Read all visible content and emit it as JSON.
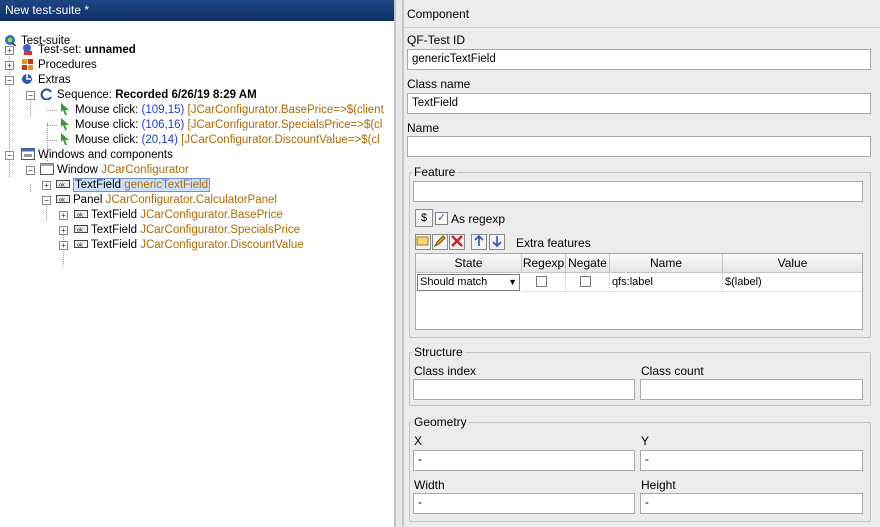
{
  "left": {
    "title": "New test-suite *",
    "tree": {
      "root": "Test-suite",
      "testset_prefix": "Test-set:",
      "testset_name": "unnamed",
      "procedures": "Procedures",
      "extras": "Extras",
      "sequence_prefix": "Sequence:",
      "sequence_name": "Recorded 6/26/19 8:29 AM",
      "clicks": [
        {
          "label": "Mouse click:",
          "coords": "(109,15)",
          "target": "[JCarConfigurator.BasePrice=>$(client"
        },
        {
          "label": "Mouse click:",
          "coords": "(106,16)",
          "target": "[JCarConfigurator.SpecialsPrice=>$(cl"
        },
        {
          "label": "Mouse click:",
          "coords": "(20,14)",
          "target": "[JCarConfigurator.DiscountValue=>$(cl"
        }
      ],
      "windows": "Windows and components",
      "window_prefix": "Window",
      "window_name": "JCarConfigurator",
      "selected_prefix": "TextField",
      "selected_name": "genericTextField",
      "panel_prefix": "Panel",
      "panel_name": "JCarConfigurator.CalculatorPanel",
      "fields": [
        {
          "prefix": "TextField",
          "name": "JCarConfigurator.BasePrice"
        },
        {
          "prefix": "TextField",
          "name": "JCarConfigurator.SpecialsPrice"
        },
        {
          "prefix": "TextField",
          "name": "JCarConfigurator.DiscountValue"
        }
      ]
    }
  },
  "right": {
    "title": "Component",
    "qf_id_label": "QF-Test ID",
    "qf_id_value": "genericTextField",
    "class_label": "Class name",
    "class_value": "TextField",
    "name_label": "Name",
    "name_value": "",
    "feature": {
      "title": "Feature",
      "value": "",
      "regexp_label": "As regexp",
      "regexp_checked": true,
      "extra_label": "Extra features",
      "columns": [
        "State",
        "Regexp",
        "Negate",
        "Name",
        "Value"
      ],
      "rows": [
        {
          "state": "Should match",
          "regexp": false,
          "negate": false,
          "name": "qfs:label",
          "value": "$(label)"
        }
      ]
    },
    "structure": {
      "title": "Structure",
      "class_index_label": "Class index",
      "class_index_value": "",
      "class_count_label": "Class count",
      "class_count_value": ""
    },
    "geometry": {
      "title": "Geometry",
      "x_label": "X",
      "x_value": "-",
      "y_label": "Y",
      "y_value": "-",
      "width_label": "Width",
      "width_value": "-",
      "height_label": "Height",
      "height_value": "-"
    }
  },
  "colors": {
    "title_bar": "#1d4585",
    "link_blue": "#1d3fc9",
    "component_orange": "#b06a00",
    "selection": "#cce0ff"
  }
}
